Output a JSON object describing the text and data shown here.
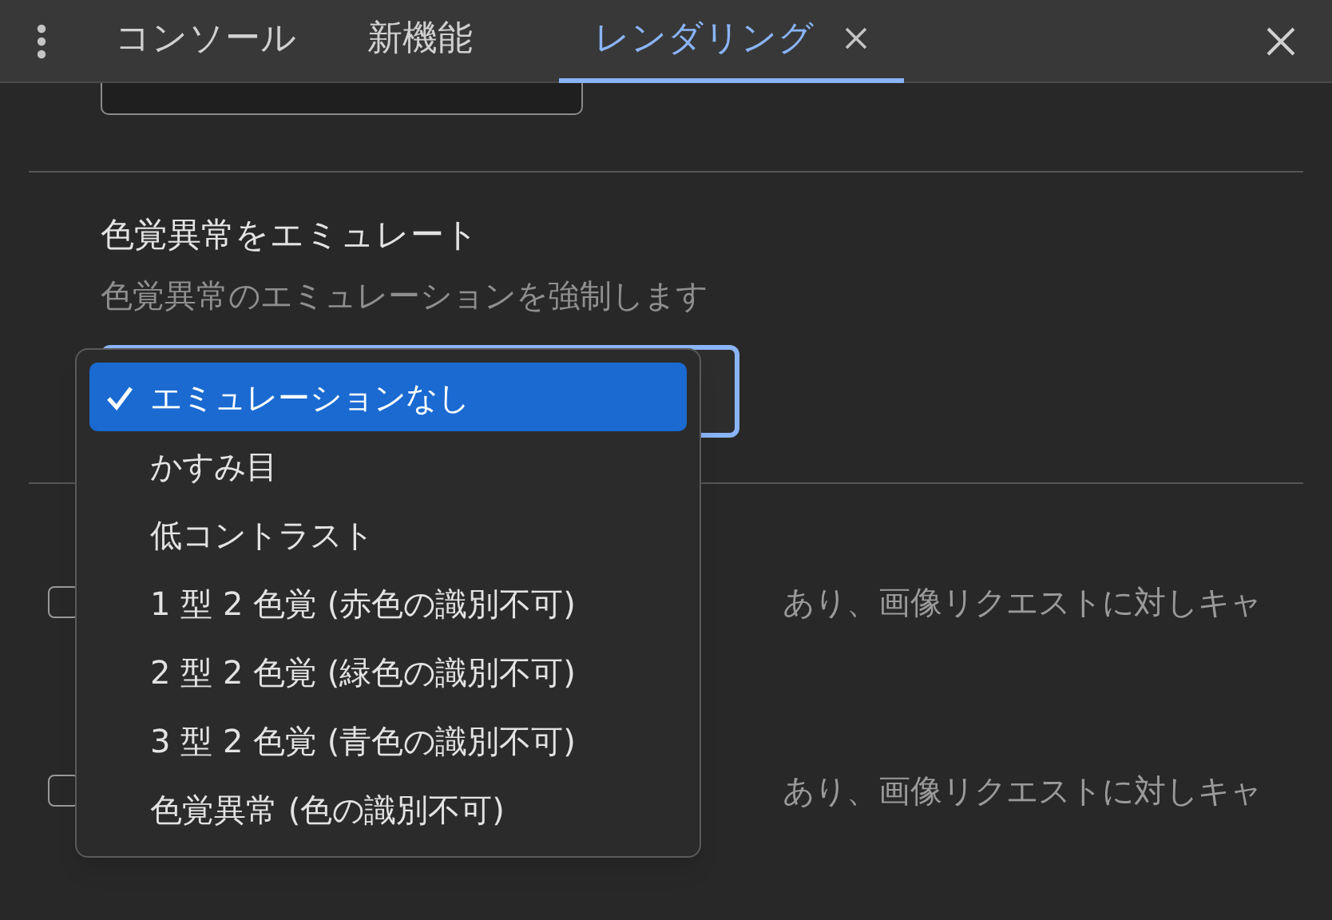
{
  "tabs": [
    {
      "label": "コンソール",
      "selected": false,
      "closable": false
    },
    {
      "label": "新機能",
      "selected": false,
      "closable": false
    },
    {
      "label": "レンダリング",
      "selected": true,
      "closable": true
    }
  ],
  "section": {
    "title": "色覚異常をエミュレート",
    "subtitle": "色覚異常のエミュレーションを強制します"
  },
  "checkbox_rows": [
    {
      "checked": false,
      "text": "あり、画像リクエストに対しキャ"
    },
    {
      "checked": false,
      "text": "あり、画像リクエストに対しキャ"
    }
  ],
  "menu": {
    "items": [
      {
        "label": "エミュレーションなし",
        "selected": true
      },
      {
        "label": "かすみ目",
        "selected": false
      },
      {
        "label": "低コントラスト",
        "selected": false
      },
      {
        "label": "1 型 2 色覚 (赤色の識別不可)",
        "selected": false
      },
      {
        "label": "2 型 2 色覚 (緑色の識別不可)",
        "selected": false
      },
      {
        "label": "3 型 2 色覚 (青色の識別不可)",
        "selected": false
      },
      {
        "label": "色覚異常 (色の識別不可)",
        "selected": false
      }
    ]
  }
}
